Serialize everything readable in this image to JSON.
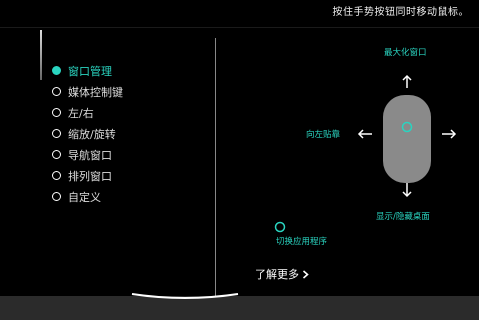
{
  "top_hint": "按住手势按钮同时移动鼠标。",
  "menu": {
    "items": [
      {
        "label": "窗口管理",
        "active": true
      },
      {
        "label": "媒体控制键",
        "active": false
      },
      {
        "label": "左/右",
        "active": false
      },
      {
        "label": "缩放/旋转",
        "active": false
      },
      {
        "label": "导航窗口",
        "active": false
      },
      {
        "label": "排列窗口",
        "active": false
      },
      {
        "label": "自定义",
        "active": false
      }
    ]
  },
  "diagram": {
    "up_label": "最大化窗口",
    "left_label": "向左贴靠",
    "down_label": "显示/隐藏桌面",
    "click_label": "切换应用程序"
  },
  "learn_more": "了解更多",
  "colors": {
    "accent": "#2ad4c0",
    "background": "#000000",
    "footer": "#2b2b2b",
    "mouse_body": "#8a8a8a"
  }
}
